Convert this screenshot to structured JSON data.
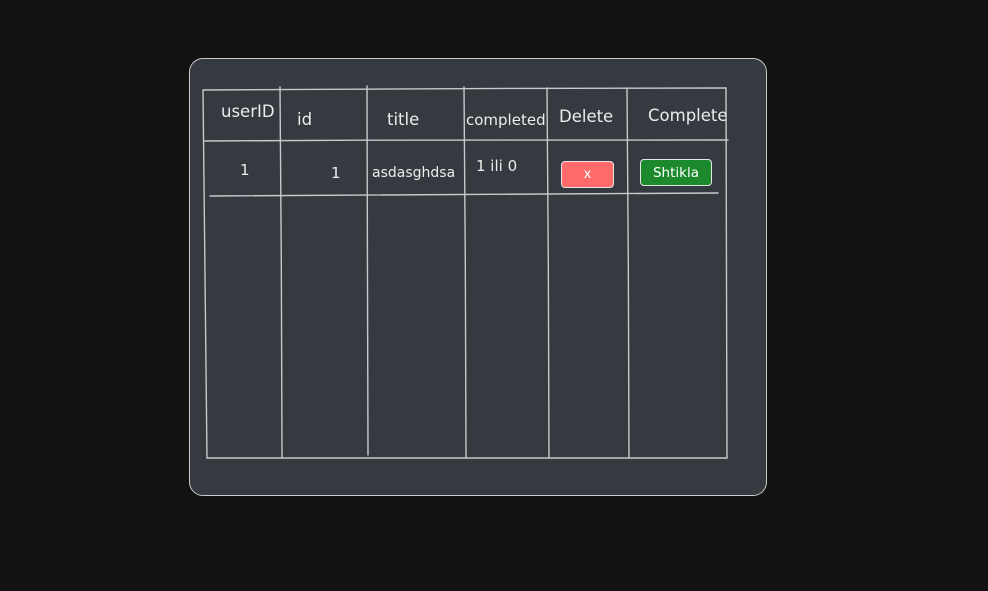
{
  "table": {
    "headers": {
      "userID": "userID",
      "id": "id",
      "title": "title",
      "completed": "completed",
      "delete": "Delete",
      "complete": "Complete"
    },
    "rows": [
      {
        "userID": "1",
        "id": "1",
        "title": "asdasghdsa",
        "completed": "1 ili 0",
        "delete_label": "x",
        "complete_label": "Shtikla"
      }
    ]
  },
  "colors": {
    "background": "#121212",
    "card": "#343a3f",
    "delete_button": "#ff6b6b",
    "complete_button": "#1c8a2c"
  }
}
